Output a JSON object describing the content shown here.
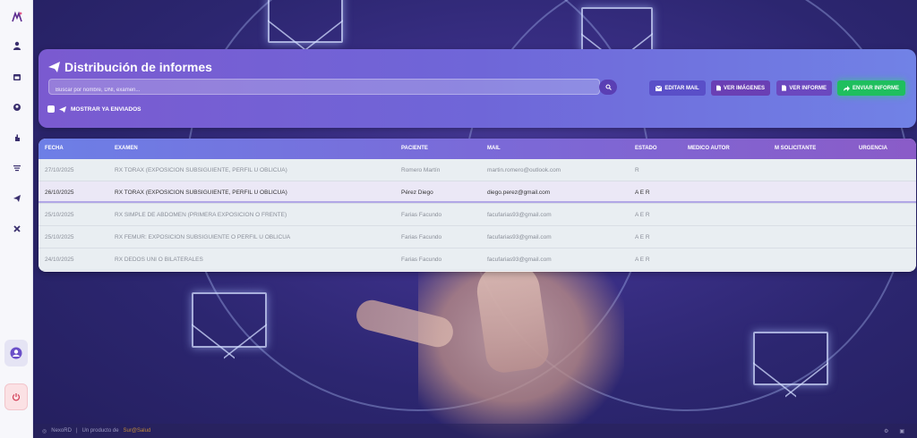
{
  "sidebar": {
    "icons": [
      "logo-icon",
      "user-icon",
      "calendar-icon",
      "location-icon",
      "hand-icon",
      "filter-icon",
      "send-icon",
      "tools-icon"
    ],
    "profile_icon": "profile-icon",
    "power_icon": "power-icon"
  },
  "header": {
    "title": "Distribución de informes",
    "search_placeholder": "Buscar por nombre, DNI, examen...",
    "show_sent_label": "MOSTRAR YA ENVIADOS",
    "buttons": {
      "edit_mail": "EDITAR MAIL",
      "view_images": "VER IMÁGENES",
      "view_report": "VER INFORME",
      "send_report": "ENVIAR INFORME"
    }
  },
  "table": {
    "columns": [
      "FECHA",
      "EXAMEN",
      "PACIENTE",
      "MAIL",
      "ESTADO",
      "MEDICO AUTOR",
      "M SOLICITANTE",
      "URGENCIA"
    ],
    "rows": [
      {
        "fecha": "27/10/2025",
        "examen": "RX TORAX (EXPOSICION SUBSIGUIENTE, PERFIL U OBLICUA)",
        "paciente": "Romero Martín",
        "mail": "martin.romero@outlook.com",
        "estado": "R"
      },
      {
        "fecha": "26/10/2025",
        "examen": "RX TORAX (EXPOSICION SUBSIGUIENTE, PERFIL U OBLICUA)",
        "paciente": "Pérez Diego",
        "mail": "diego.perez@gmail.com",
        "estado": "A E R"
      },
      {
        "fecha": "25/10/2025",
        "examen": "RX SIMPLE DE ABDOMEN (PRIMERA EXPOSICION O FRENTE)",
        "paciente": "Farias Facundo",
        "mail": "facufarias93@gmail.com",
        "estado": "A E R"
      },
      {
        "fecha": "25/10/2025",
        "examen": "RX FEMUR: EXPOSICION SUBSIGUIENTE O PERFIL U OBLICUA",
        "paciente": "Farias Facundo",
        "mail": "facufarias93@gmail.com",
        "estado": "A E R"
      },
      {
        "fecha": "24/10/2025",
        "examen": "RX DEDOS UNI O BILATERALES",
        "paciente": "Farias Facundo",
        "mail": "facufarias93@gmail.com",
        "estado": "A E R"
      }
    ]
  },
  "footer": {
    "app": "NexoRD",
    "separator": "|",
    "product_of": "Un producto de",
    "brand": "Sur@Salud"
  },
  "colors": {
    "accent": "#7a5ad0",
    "send": "#1fbf5e",
    "header_end": "#7182e6"
  }
}
